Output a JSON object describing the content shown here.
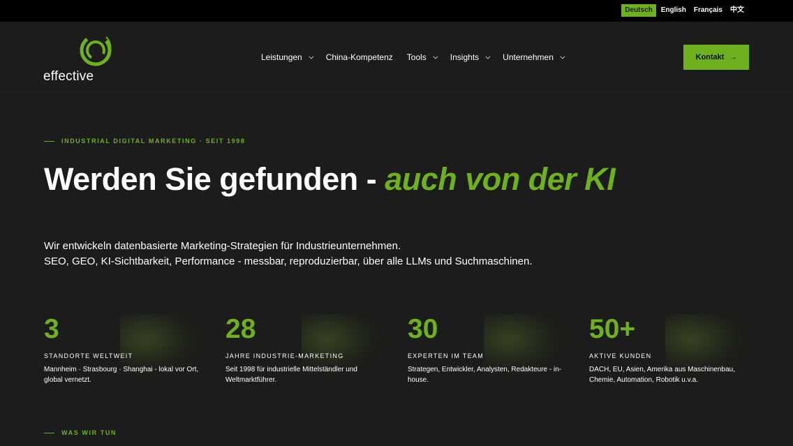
{
  "languages": [
    {
      "label": "Deutsch",
      "active": true
    },
    {
      "label": "English",
      "active": false
    },
    {
      "label": "Français",
      "active": false
    },
    {
      "label": "中文",
      "active": false
    }
  ],
  "logo": {
    "text": "effective",
    "icon": "swirl-logo-icon"
  },
  "nav": {
    "items": [
      {
        "label": "Leistungen",
        "dropdown": true
      },
      {
        "label": "China-Kompetenz",
        "dropdown": false
      },
      {
        "label": "Tools",
        "dropdown": true
      },
      {
        "label": "Insights",
        "dropdown": true
      },
      {
        "label": "Unternehmen",
        "dropdown": true
      }
    ]
  },
  "cta": {
    "label": "Kontakt",
    "arrow": "→"
  },
  "hero": {
    "eyebrow": "INDUSTRIAL DIGITAL MARKETING · SEIT 1998",
    "title_main": "Werden Sie gefunden - ",
    "title_accent": "auch von der KI",
    "sub_line1": "Wir entwickeln datenbasierte Marketing-Strategien für Industrieunternehmen.",
    "sub_line2": "SEO, GEO, KI-Sichtbarkeit, Performance - messbar, reproduzierbar, über alle LLMs und Suchmaschinen."
  },
  "stats": [
    {
      "value": "3",
      "label": "STANDORTE WELTWEIT",
      "desc": "Mannheim · Strasbourg · Shanghai - lokal vor Ort, global vernetzt."
    },
    {
      "value": "28",
      "label": "JAHRE INDUSTRIE-MARKETING",
      "desc": "Seit 1998 für industrielle Mittelständler und Weltmarktführer."
    },
    {
      "value": "30",
      "label": "EXPERTEN IM TEAM",
      "desc": "Strategen, Entwickler, Analysten, Redakteure - in-house."
    },
    {
      "value": "50+",
      "label": "AKTIVE KUNDEN",
      "desc": "DACH, EU, Asien, Amerika aus Maschinenbau, Chemie, Automation, Robotik u.v.a."
    }
  ],
  "next_section": {
    "eyebrow": "WAS WIR TUN"
  },
  "colors": {
    "accent": "#6fb01e",
    "background": "#1c1c1c",
    "topbar": "#000000"
  }
}
